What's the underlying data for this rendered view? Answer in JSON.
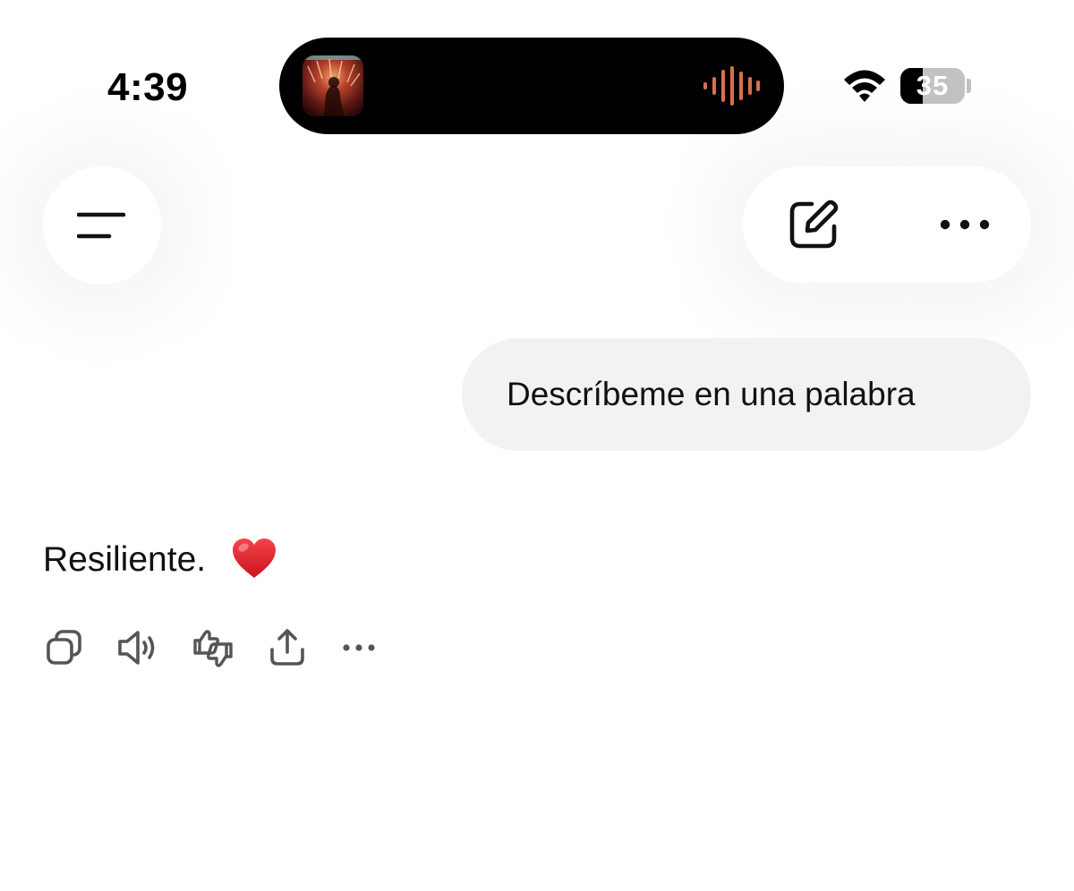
{
  "status_bar": {
    "time": "4:39",
    "battery_percent": "35",
    "battery_level": 0.35,
    "wifi_icon": "wifi-icon",
    "now_playing_icon": "album-art",
    "audio_indicator_icon": "waveform-icon"
  },
  "header": {
    "menu_icon": "menu-icon",
    "new_chat_icon": "compose-icon",
    "more_icon": "ellipsis-icon"
  },
  "conversation": {
    "user_message": "Descríbeme en una palabra",
    "assistant_message": "Resiliente.",
    "assistant_emoji": "heart-emoji"
  },
  "actions": [
    {
      "icon": "copy-icon"
    },
    {
      "icon": "speaker-icon"
    },
    {
      "icon": "thumbs-icon"
    },
    {
      "icon": "share-icon"
    },
    {
      "icon": "ellipsis-icon"
    }
  ],
  "colors": {
    "background": "#ffffff",
    "user_bubble": "#f2f2f2",
    "text": "#111111",
    "icon": "#555555",
    "island": "#000000",
    "waveform": "#d8704f",
    "heart": "#e3262f"
  }
}
